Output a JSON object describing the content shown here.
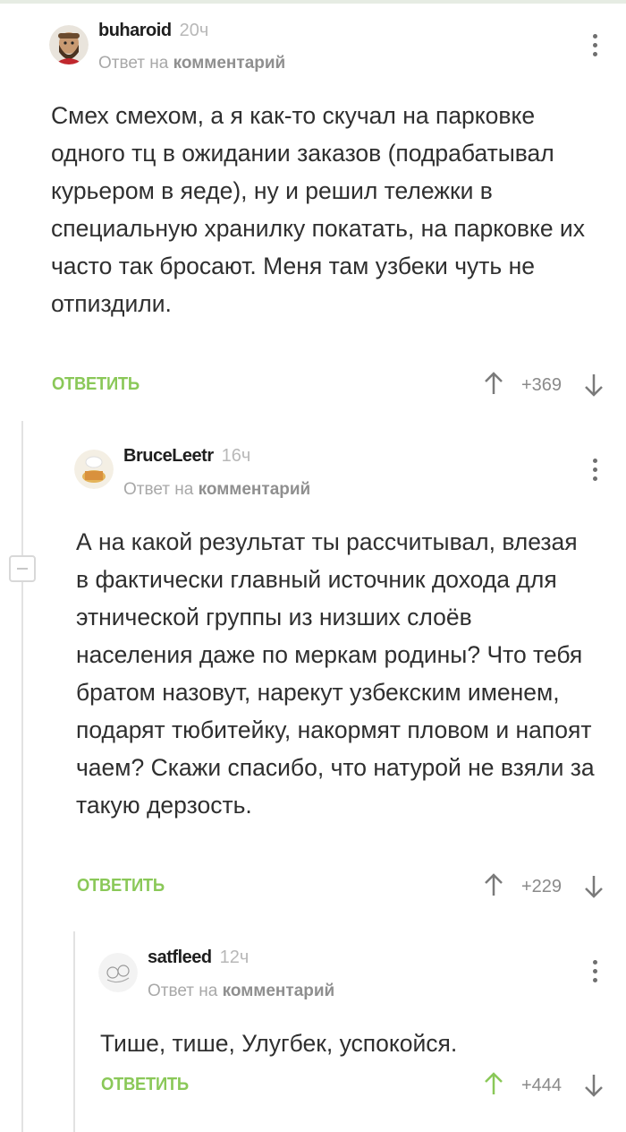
{
  "comments": [
    {
      "username": "buharoid",
      "time": "20ч",
      "reply_prefix": "Ответ на",
      "reply_target": "комментарий",
      "text": "Смех смехом, а я как-то скучал на парковке одного тц в ожидании заказов (подрабатывал курьером в яеде), ну и решил тележки в специальную хранилку покатать, на парковке их часто так бросают. Меня там узбеки чуть не отпиздили.",
      "reply_label": "ОТВЕТИТЬ",
      "rating": "+369",
      "upvoted": false
    },
    {
      "username": "BruceLeetr",
      "time": "16ч",
      "reply_prefix": "Ответ на",
      "reply_target": "комментарий",
      "text": "А на какой результат ты рассчитывал, влезая в фактически главный источник дохода для этнической группы из низших слоёв населения даже по меркам родины? Что тебя братом назовут, нарекут узбекским именем, подарят тюбитейку, накормят пловом и напоят чаем? Скажи спасибо, что натурой не взяли за такую дерзость.",
      "reply_label": "ОТВЕТИТЬ",
      "rating": "+229",
      "upvoted": false
    },
    {
      "username": "satfleed",
      "time": "12ч",
      "reply_prefix": "Ответ на",
      "reply_target": "комментарий",
      "text": "Тише, тише, Улугбек, успокойся.",
      "reply_label": "ОТВЕТИТЬ",
      "rating": "+444",
      "upvoted": true
    }
  ],
  "colors": {
    "accent_green": "#8ac858",
    "arrow_gray": "#7a7a7a",
    "thread_line": "#e2e2e2"
  },
  "icons": [
    "avatar-image",
    "more-vertical-icon",
    "arrow-up-icon",
    "arrow-down-icon",
    "collapse-thread-icon"
  ]
}
